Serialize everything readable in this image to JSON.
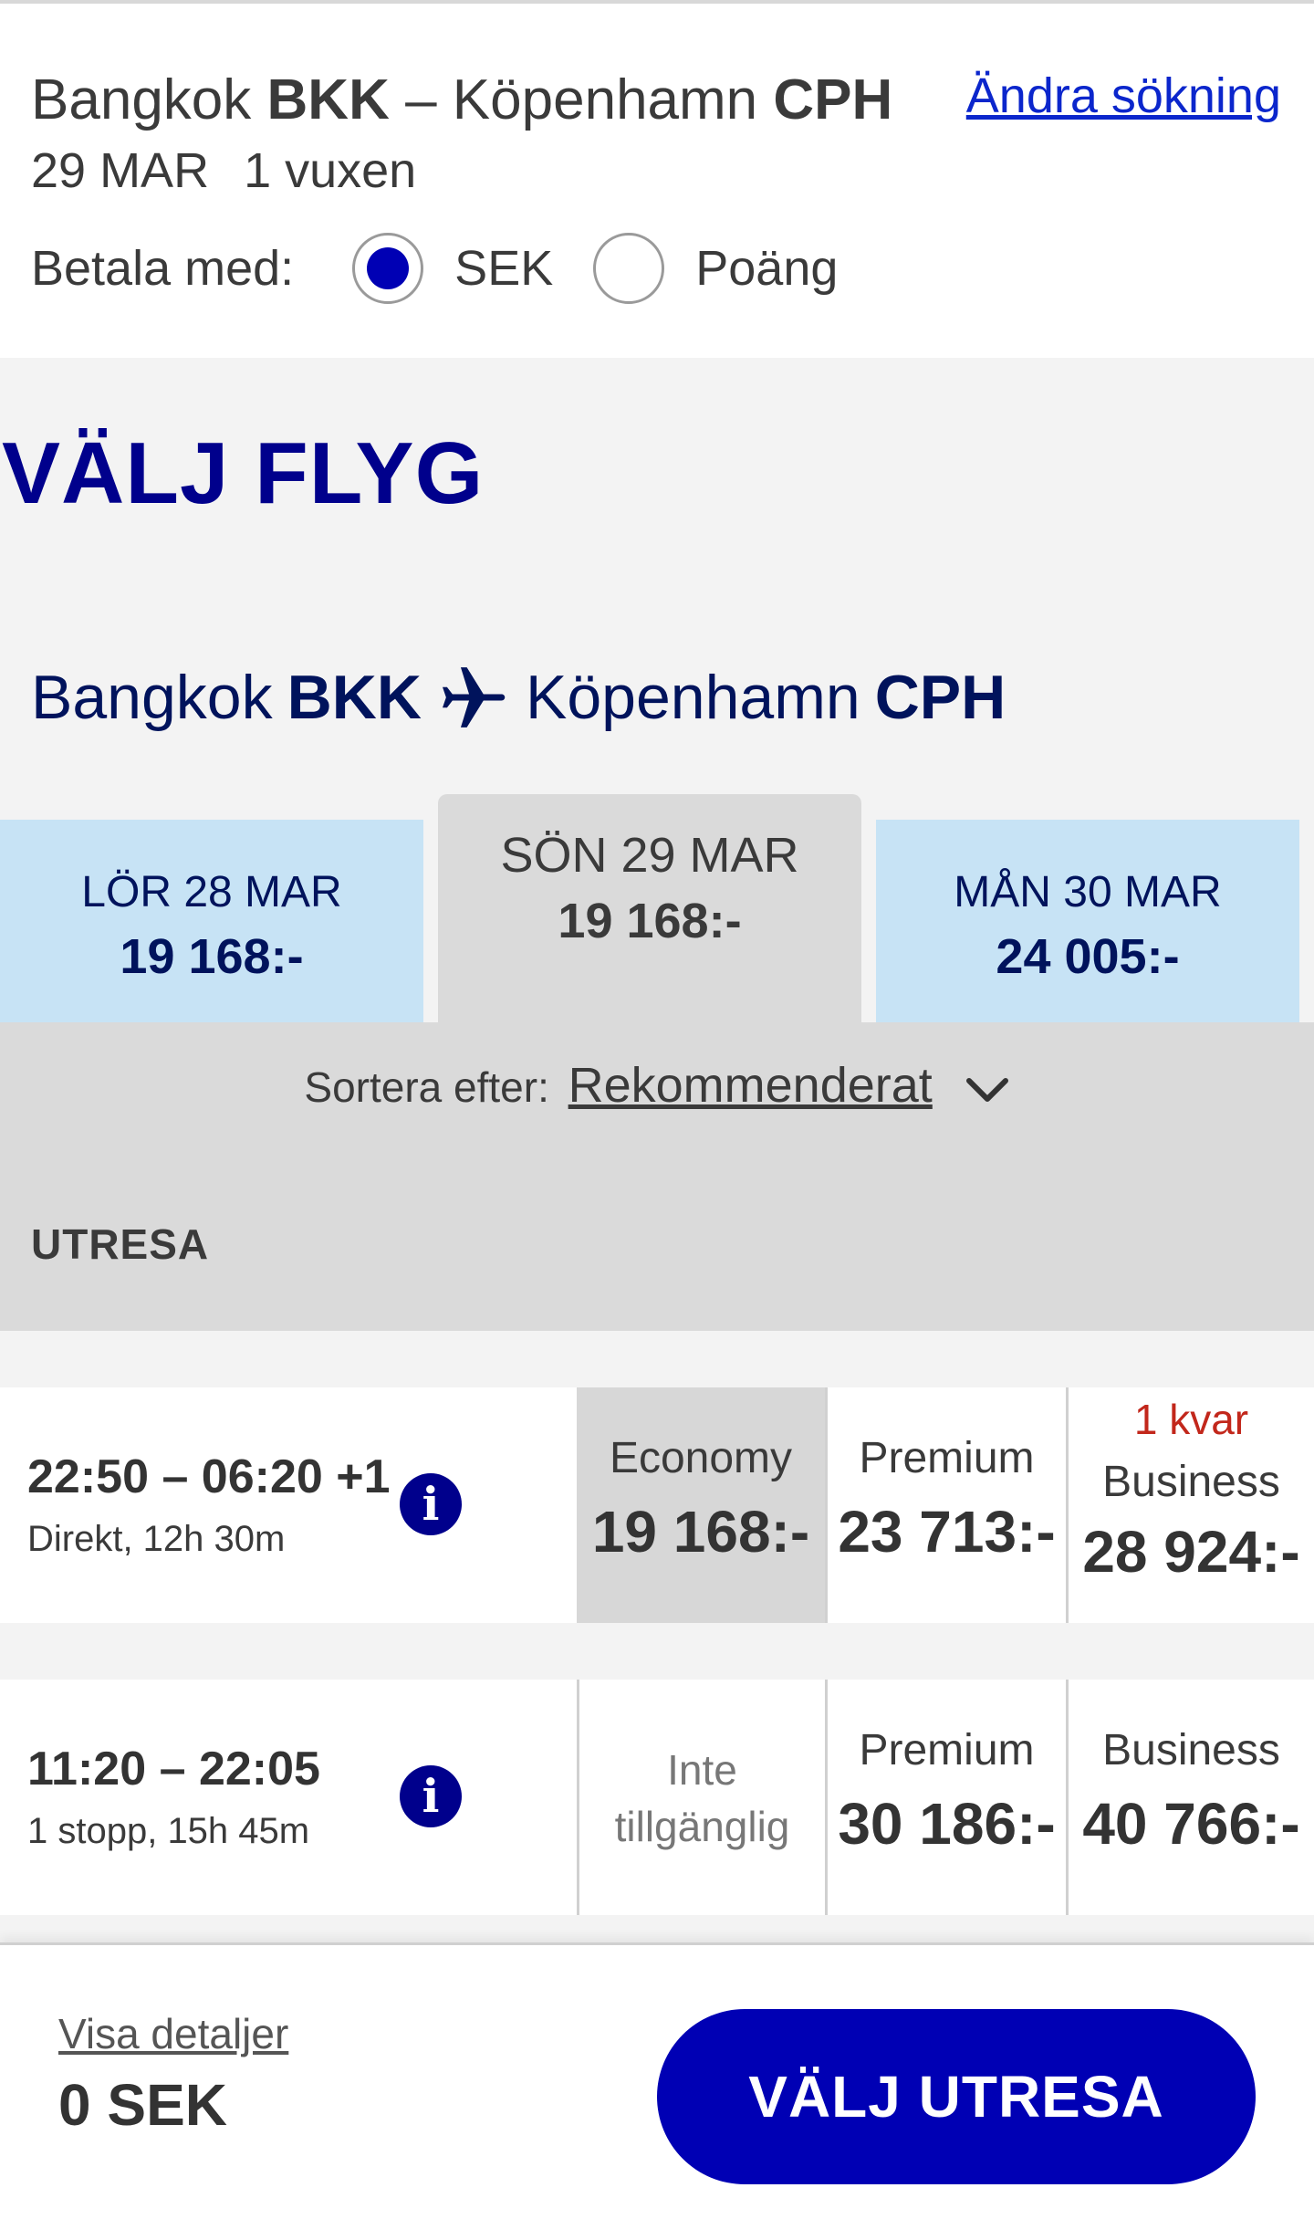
{
  "summary": {
    "from_city": "Bangkok",
    "from_code": "BKK",
    "separator": "–",
    "to_city": "Köpenhamn",
    "to_code": "CPH",
    "date": "29 MAR",
    "passengers": "1 vuxen",
    "change_search": "Ändra sökning",
    "pay_with_label": "Betala med:",
    "pay_options": [
      {
        "label": "SEK",
        "selected": true
      },
      {
        "label": "Poäng",
        "selected": false
      }
    ]
  },
  "main": {
    "title": "VÄLJ FLYG",
    "route": {
      "from_city": "Bangkok",
      "from_code": "BKK",
      "to_city": "Köpenhamn",
      "to_code": "CPH",
      "icon": "plane-icon"
    }
  },
  "date_tabs": [
    {
      "label": "LÖR 28 MAR",
      "price": "19 168:-",
      "active": false
    },
    {
      "label": "SÖN 29 MAR",
      "price": "19 168:-",
      "active": true
    },
    {
      "label": "MÅN 30 MAR",
      "price": "24 005:-",
      "active": false
    }
  ],
  "sort": {
    "label": "Sortera efter:",
    "value": "Rekommenderat",
    "icon": "chevron-down-icon"
  },
  "section_heading": "UTRESA",
  "flights": [
    {
      "times": "22:50 – 06:20 +1",
      "details": "Direkt, 12h 30m",
      "fares": [
        {
          "class": "Economy",
          "price": "19 168:-",
          "selected": true
        },
        {
          "class": "Premium",
          "price": "23 713:-",
          "selected": false
        },
        {
          "class": "Business",
          "price": "28 924:-",
          "note": "1 kvar",
          "selected": false
        }
      ]
    },
    {
      "times": "11:20 – 22:05",
      "details": "1 stopp, 15h 45m",
      "fares": [
        {
          "unavailable_line1": "Inte",
          "unavailable_line2": "tillgänglig"
        },
        {
          "class": "Premium",
          "price": "30 186:-",
          "selected": false
        },
        {
          "class": "Business",
          "price": "40 766:-",
          "selected": false
        }
      ]
    }
  ],
  "footer": {
    "details_link": "Visa detaljer",
    "total": "0 SEK",
    "cta": "VÄLJ UTRESA"
  },
  "colors": {
    "brand_blue": "#00008c",
    "cta_blue": "#0000b4",
    "link_blue": "#0b26cc",
    "tab_light_blue": "#c7e3f5",
    "warning_red": "#c2271b"
  }
}
